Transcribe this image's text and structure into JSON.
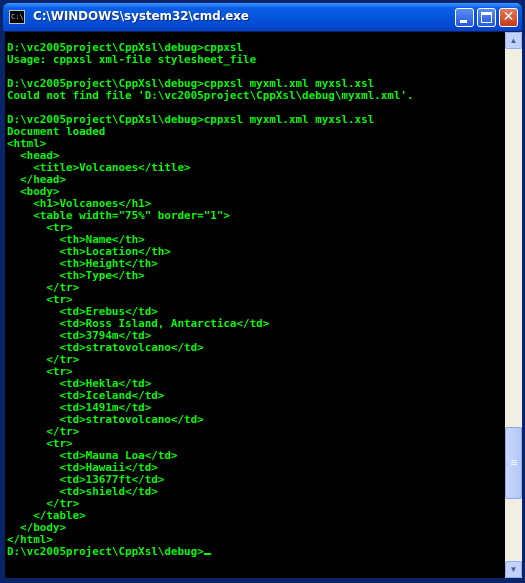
{
  "window": {
    "title": "C:\\WINDOWS\\system32\\cmd.exe",
    "icon": "console-icon",
    "icon_label": "C:\\"
  },
  "console": {
    "text_color": "#00ff00",
    "background_color": "#000000",
    "lines": [
      "D:\\vc2005project\\CppXsl\\debug>cppxsl",
      "Usage: cppxsl xml-file stylesheet_file",
      "",
      "D:\\vc2005project\\CppXsl\\debug>cppxsl myxml.xml myxsl.xsl",
      "Could not find file 'D:\\vc2005project\\CppXsl\\debug\\myxml.xml'.",
      "",
      "D:\\vc2005project\\CppXsl\\debug>cppxsl myxml.xml myxsl.xsl",
      "Document loaded",
      "<html>",
      "  <head>",
      "    <title>Volcanoes</title>",
      "  </head>",
      "  <body>",
      "    <h1>Volcanoes</h1>",
      "    <table width=\"75%\" border=\"1\">",
      "      <tr>",
      "        <th>Name</th>",
      "        <th>Location</th>",
      "        <th>Height</th>",
      "        <th>Type</th>",
      "      </tr>",
      "      <tr>",
      "        <td>Erebus</td>",
      "        <td>Ross Island, Antarctica</td>",
      "        <td>3794m</td>",
      "        <td>stratovolcano</td>",
      "      </tr>",
      "      <tr>",
      "        <td>Hekla</td>",
      "        <td>Iceland</td>",
      "        <td>1491m</td>",
      "        <td>stratovolcano</td>",
      "      </tr>",
      "      <tr>",
      "        <td>Mauna Loa</td>",
      "        <td>Hawaii</td>",
      "        <td>13677ft</td>",
      "        <td>shield</td>",
      "      </tr>",
      "    </table>",
      "  </body>",
      "</html>",
      "D:\\vc2005project\\CppXsl\\debug>"
    ]
  },
  "scrollbar": {
    "up_icon": "scroll-up-icon",
    "down_icon": "scroll-down-icon",
    "up_glyph": "▲",
    "down_glyph": "▼",
    "thumb_position": 0.86,
    "thumb_fraction": 0.14
  }
}
